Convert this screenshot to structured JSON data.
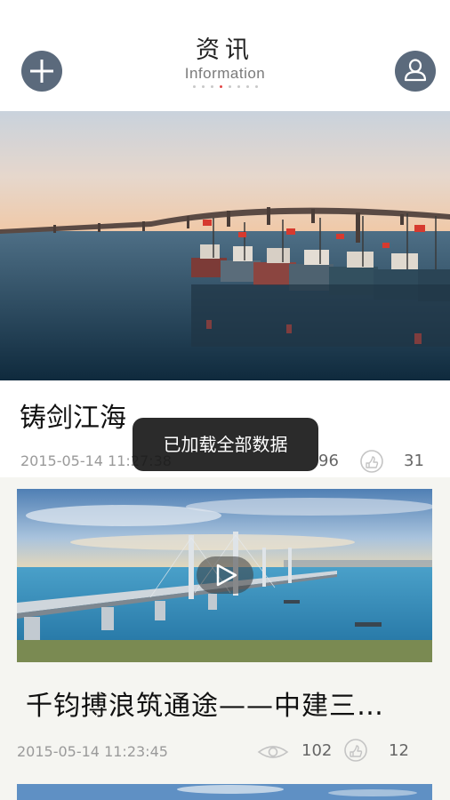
{
  "header": {
    "title": "资讯",
    "subtitle": "Information",
    "add_icon": "plus-circle-icon",
    "profile_icon": "user-icon",
    "accent_color": "#5b6a7c",
    "active_dot_color": "#e44848",
    "active_page_index": 4
  },
  "articles": [
    {
      "title": "铸剑江海",
      "date": "2015-05-14 11:27:38",
      "views": "96",
      "likes": "31",
      "image": "bridge-and-fishing-boats-photo"
    },
    {
      "title": "千钧搏浪筑通途——中建三…",
      "date": "2015-05-14 11:23:45",
      "views": "102",
      "likes": "12",
      "image": "cable-stayed-bridge-photo",
      "has_video": true
    }
  ],
  "toast": {
    "message": "已加载全部数据"
  }
}
